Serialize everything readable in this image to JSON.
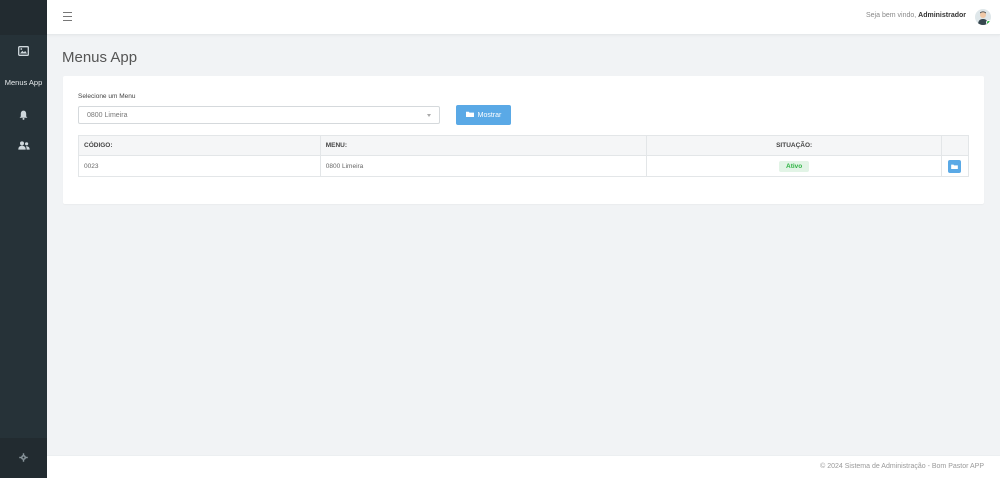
{
  "sidebar": {
    "items": [
      {
        "icon": "image-icon"
      },
      {
        "label": "Menus App"
      },
      {
        "icon": "bell-icon"
      },
      {
        "icon": "users-icon"
      }
    ],
    "footer_icon": "gear-icon"
  },
  "topbar": {
    "welcome_prefix": "Seja bem vindo,",
    "user_name": "Administrador"
  },
  "page": {
    "title": "Menus App"
  },
  "form": {
    "select_label": "Selecione um Menu",
    "select_value": "0800 Limeira",
    "button_label": "Mostrar"
  },
  "table": {
    "headers": [
      "CÓDIGO:",
      "MENU:",
      "SITUAÇÃO:",
      ""
    ],
    "rows": [
      {
        "codigo": "0023",
        "menu": "0800 Limeira",
        "situacao": "Ativo"
      }
    ]
  },
  "footer": {
    "text": "© 2024 Sistema de Administração - Bom Pastor APP"
  },
  "colors": {
    "sidebar_bg": "#263238",
    "accent": "#5aa9e6",
    "status_active": "#2fb344"
  }
}
